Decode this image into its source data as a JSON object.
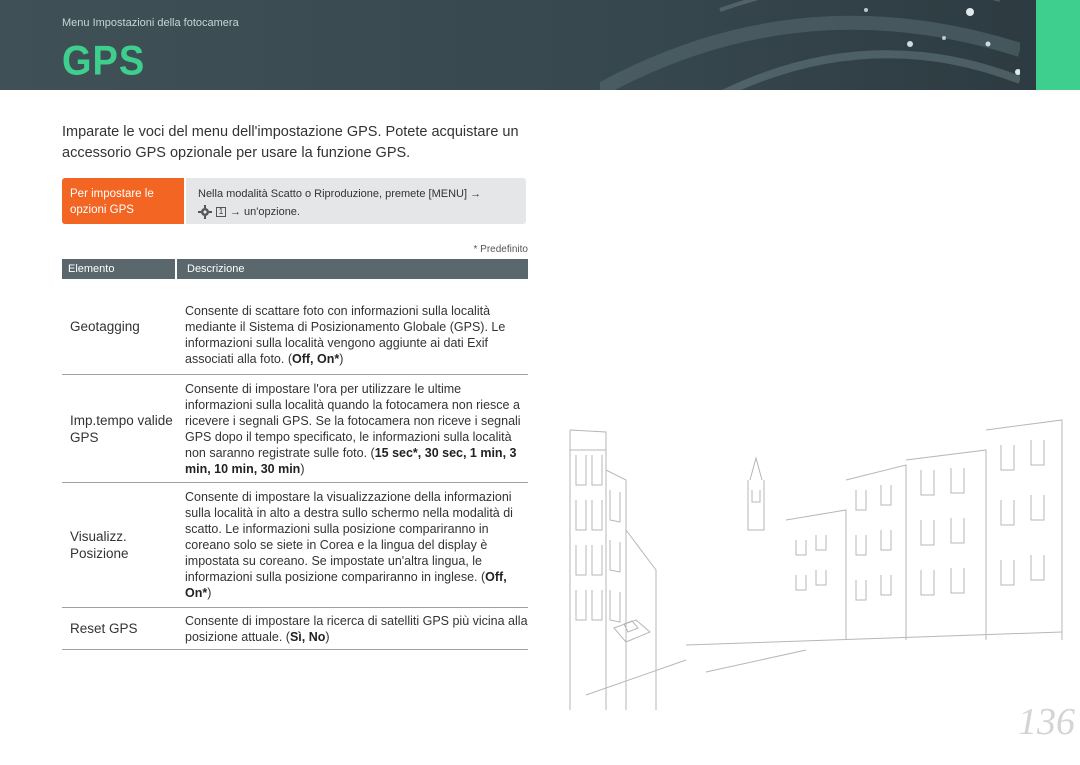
{
  "header": {
    "breadcrumb": "Menu Impostazioni della fotocamera",
    "title": "GPS"
  },
  "intro": "Imparate le voci del menu dell'impostazione GPS. Potete acquistare un accessorio GPS opzionale per usare la funzione GPS.",
  "note": {
    "label": "Per impostare le opzioni GPS",
    "line1": "Nella modalità Scatto o Riproduzione, premete [MENU] →",
    "line2": "→ un'opzione."
  },
  "default_note": "* Predefinito",
  "table": {
    "headers": [
      "Elemento",
      "Descrizione"
    ],
    "rows": [
      {
        "item": "Geotagging",
        "desc": "Consente di scattare foto con informazioni sulla località mediante il Sistema di Posizionamento Globale (GPS). Le informazioni sulla località vengono aggiunte ai dati Exif associati alla foto. (",
        "options": "Off, On*",
        "suffix": ")"
      },
      {
        "item": "Imp.tempo valide GPS",
        "desc": "Consente di impostare l'ora per utilizzare le ultime informazioni sulla località quando la fotocamera non riesce a ricevere i segnali GPS. Se la fotocamera non riceve i segnali GPS dopo il tempo specificato, le informazioni sulla località non saranno registrate sulle foto. (",
        "options": "15 sec*, 30 sec, 1 min, 3 min, 10 min, 30 min",
        "suffix": ")"
      },
      {
        "item": "Visualizz. Posizione",
        "desc": "Consente di impostare la visualizzazione della informazioni sulla località in alto a destra sullo schermo nella modalità di scatto. Le informazioni sulla posizione compariranno in coreano solo se siete in Corea e la lingua del display è impostata su coreano. Se impostate un'altra lingua, le informazioni sulla posizione compariranno in inglese. (",
        "options": "Off, On*",
        "suffix": ")"
      },
      {
        "item": "Reset GPS",
        "desc": "Consente di impostare la ricerca di satelliti GPS più vicina alla posizione attuale. (",
        "options": "Sì, No",
        "suffix": ")"
      }
    ]
  },
  "page_number": "136",
  "colors": {
    "header_bg": "#3f5157",
    "accent_green": "#3ecf8e",
    "note_orange": "#f26522",
    "table_header": "#5a676c"
  }
}
